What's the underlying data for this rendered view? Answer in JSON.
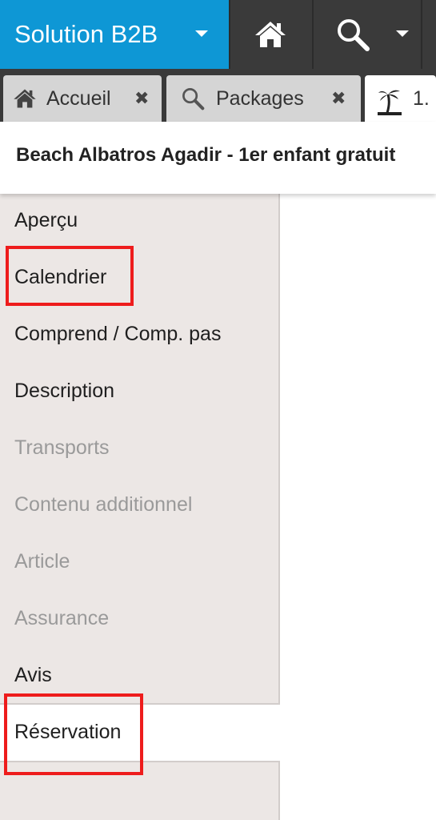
{
  "app": {
    "brand": "Solution B2B"
  },
  "toolbar": {
    "home_icon": "home-icon",
    "search_icon": "search-icon"
  },
  "tabs": [
    {
      "icon": "home-icon",
      "label": "Accueil",
      "closable": true
    },
    {
      "icon": "search-icon",
      "label": "Packages",
      "closable": true
    },
    {
      "icon": "palm-tree-icon",
      "label": "1.",
      "active": true
    }
  ],
  "header": {
    "title": "Beach Albatros Agadir - 1er enfant gratuit"
  },
  "sidebar": {
    "items": [
      {
        "label": "Aperçu",
        "state": "enabled"
      },
      {
        "label": "Calendrier",
        "state": "enabled",
        "highlighted": true
      },
      {
        "label": "Comprend / Comp. pas",
        "state": "enabled"
      },
      {
        "label": "Description",
        "state": "enabled"
      },
      {
        "label": "Transports",
        "state": "disabled"
      },
      {
        "label": "Contenu additionnel",
        "state": "disabled"
      },
      {
        "label": "Article",
        "state": "disabled"
      },
      {
        "label": "Assurance",
        "state": "disabled"
      },
      {
        "label": "Avis",
        "state": "enabled"
      },
      {
        "label": "Réservation",
        "state": "active",
        "highlighted": true
      }
    ]
  },
  "colors": {
    "brand": "#0e97d5",
    "toolbar": "#3a3a3a",
    "sidebar": "#ece7e5",
    "highlight": "#ee1c1c",
    "disabled_text": "#9a9a9a"
  }
}
